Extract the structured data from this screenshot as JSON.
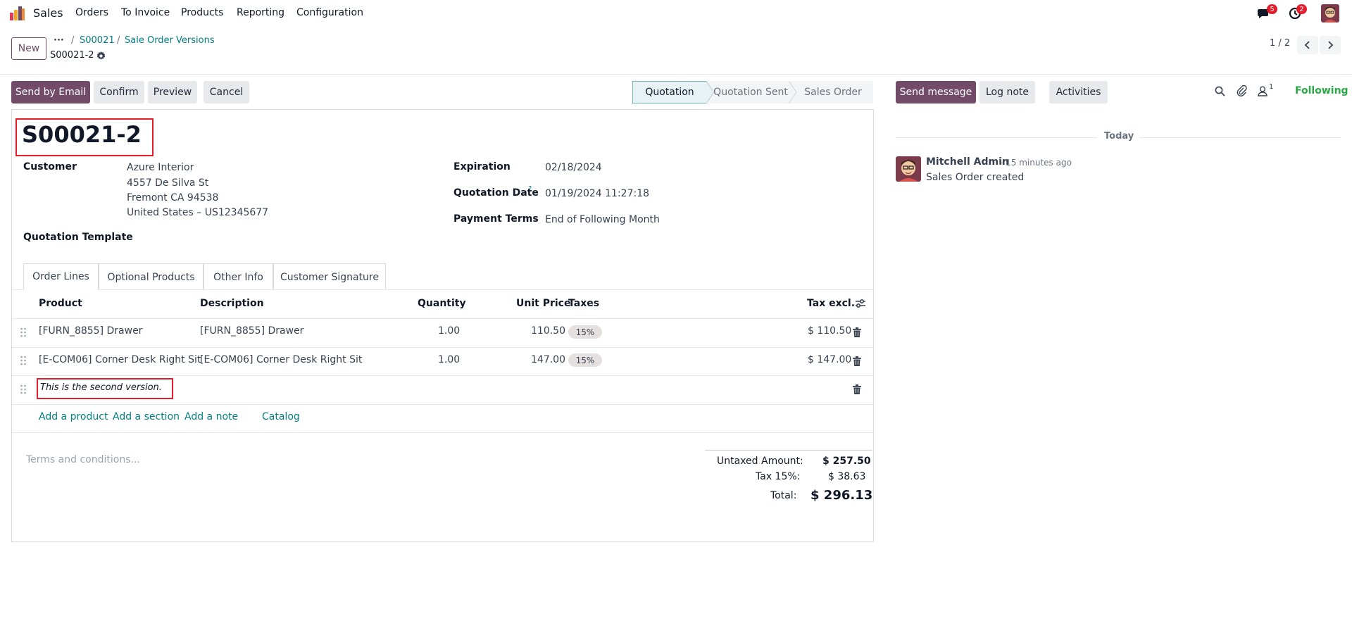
{
  "nav": {
    "app_name": "Sales",
    "menu": [
      "Orders",
      "To Invoice",
      "Products",
      "Reporting",
      "Configuration"
    ],
    "messages_count": "5",
    "activities_count": "2"
  },
  "control": {
    "new_label": "New",
    "breadcrumb_more": "···",
    "breadcrumb": [
      "S00021",
      "Sale Order Versions"
    ],
    "record_name": "S00021-2",
    "pager": "1 / 2"
  },
  "actions": {
    "send_email": "Send by Email",
    "confirm": "Confirm",
    "preview": "Preview",
    "cancel": "Cancel"
  },
  "status_bar": [
    "Quotation",
    "Quotation Sent",
    "Sales Order"
  ],
  "form": {
    "title": "S00021-2",
    "customer_label": "Customer",
    "customer_lines": [
      "Azure Interior",
      "4557 De Silva St",
      "Fremont CA 94538",
      "United States – US12345677"
    ],
    "template_label": "Quotation Template",
    "expiration_label": "Expiration",
    "expiration_value": "02/18/2024",
    "quotation_date_label": "Quotation Date",
    "quotation_date_help": "?",
    "quotation_date_value": "01/19/2024 11:27:18",
    "payment_terms_label": "Payment Terms",
    "payment_terms_value": "End of Following Month"
  },
  "tabs": [
    "Order Lines",
    "Optional Products",
    "Other Info",
    "Customer Signature"
  ],
  "table": {
    "headers": {
      "product": "Product",
      "description": "Description",
      "quantity": "Quantity",
      "unit_price": "Unit Price",
      "taxes": "Taxes",
      "tax_excl": "Tax excl."
    },
    "rows": [
      {
        "product": "[FURN_8855] Drawer",
        "description": "[FURN_8855] Drawer",
        "quantity": "1.00",
        "unit_price": "110.50",
        "tax": "15%",
        "subtotal": "$ 110.50"
      },
      {
        "product": "[E-COM06] Corner Desk Right Sit",
        "description": "[E-COM06] Corner Desk Right Sit",
        "quantity": "1.00",
        "unit_price": "147.00",
        "tax": "15%",
        "subtotal": "$ 147.00"
      }
    ],
    "note": "This is the second version.",
    "add_product": "Add a product",
    "add_section": "Add a section",
    "add_note": "Add a note",
    "catalog": "Catalog"
  },
  "terms_placeholder": "Terms and conditions...",
  "totals": {
    "untaxed_label": "Untaxed Amount:",
    "untaxed_value": "$ 257.50",
    "tax_label": "Tax 15%:",
    "tax_value": "$ 38.63",
    "total_label": "Total:",
    "total_value": "$ 296.13"
  },
  "chatter": {
    "send_message": "Send message",
    "log_note": "Log note",
    "activities": "Activities",
    "followers_count": "1",
    "following": "Following",
    "date_separator": "Today",
    "message_author": "Mitchell Admin",
    "message_time": "- 15 minutes ago",
    "message_body": "Sales Order created"
  },
  "colors": {
    "brand": "#714B67",
    "link": "#017e84",
    "following": "#28a745",
    "badge_red": "#e11d2e",
    "highlight": "#e11d2e"
  }
}
